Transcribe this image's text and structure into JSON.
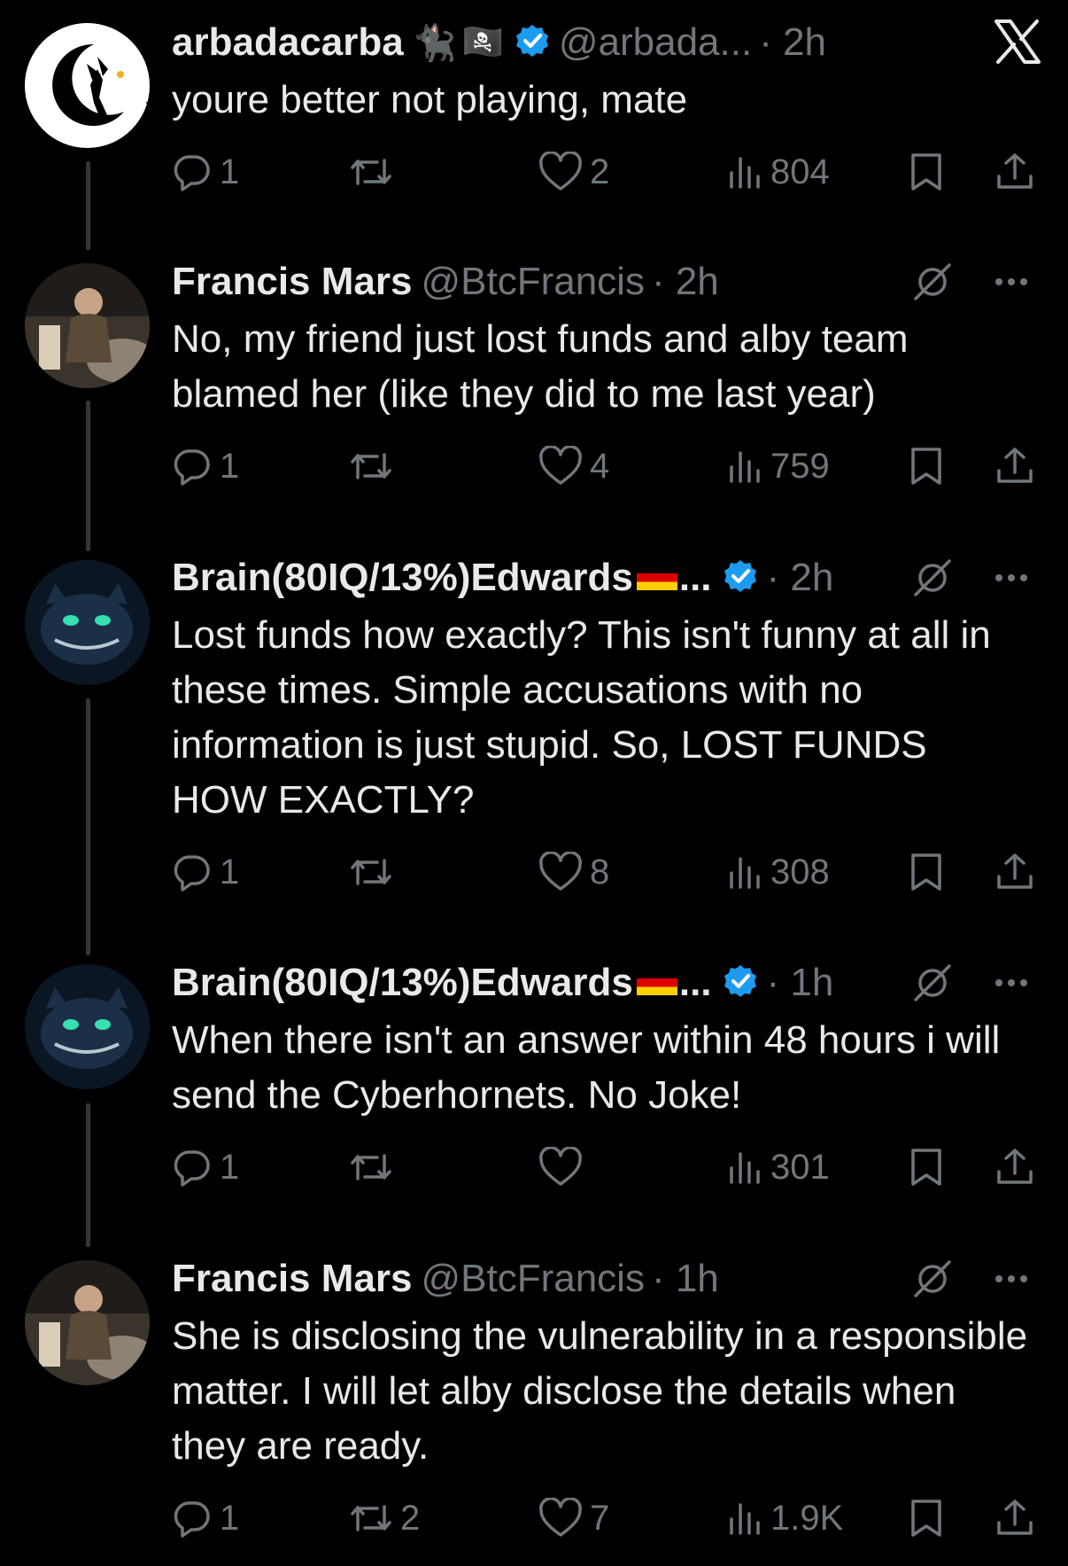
{
  "close_icon": "x-logo-icon",
  "tweets": [
    {
      "name": "arbadacarba",
      "handle": "@arbada...",
      "time": "· 2h",
      "verified": true,
      "text": "youre better not playing, mate",
      "replies": "1",
      "reposts": "",
      "likes": "2",
      "views": "804"
    },
    {
      "name": "Francis Mars",
      "handle": "@BtcFrancis",
      "time": "· 2h",
      "verified": false,
      "text": "No, my friend just lost funds and alby team blamed her (like they did to me last year)",
      "replies": "1",
      "reposts": "",
      "likes": "4",
      "views": "759"
    },
    {
      "name": "Brain(80IQ/13%)Edwards",
      "handle": "...",
      "time": "· 2h",
      "verified": true,
      "text": "Lost funds how exactly? This isn't funny at all in these times. Simple accusations with no information is just stupid. So, LOST FUNDS HOW EXACTLY?",
      "replies": "1",
      "reposts": "",
      "likes": "8",
      "views": "308"
    },
    {
      "name": "Brain(80IQ/13%)Edwards",
      "handle": "...",
      "time": "· 1h",
      "verified": true,
      "text": "When there isn't an answer within 48 hours i will send the Cyberhornets. No Joke!",
      "replies": "1",
      "reposts": "",
      "likes": "",
      "views": "301"
    },
    {
      "name": "Francis Mars",
      "handle": "@BtcFrancis",
      "time": "· 1h",
      "verified": false,
      "text": "She is disclosing the vulnerability in a responsible matter. I will let alby disclose the details when they are ready.",
      "replies": "1",
      "reposts": "2",
      "likes": "7",
      "views": "1.9K"
    }
  ]
}
